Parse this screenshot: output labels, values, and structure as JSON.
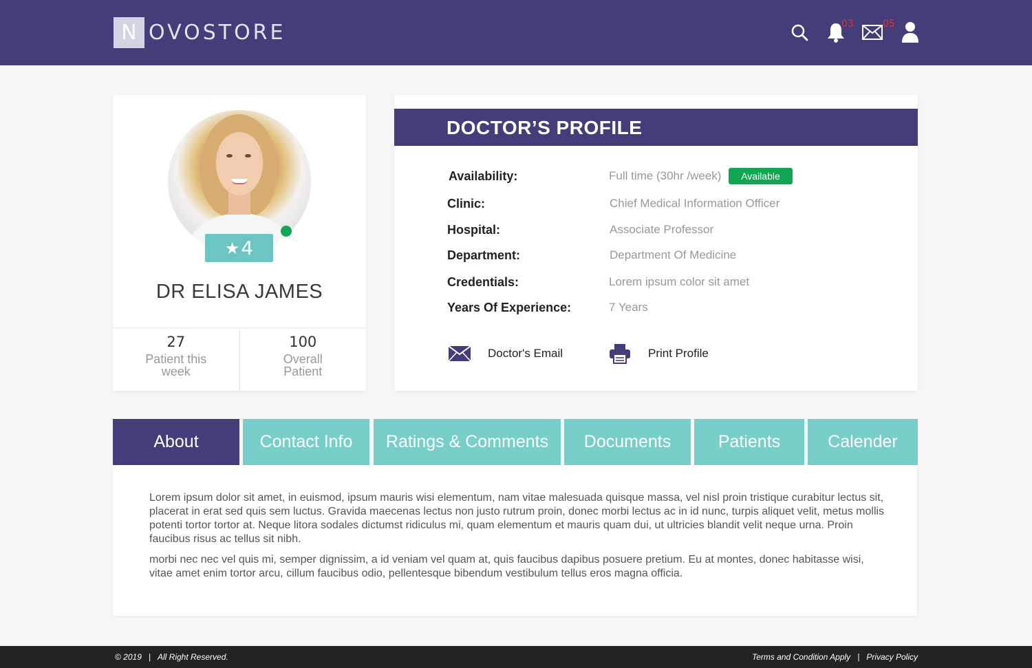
{
  "brand": {
    "logo_letter": "N",
    "logo_rest": "OVOSTORE"
  },
  "header": {
    "notifications_count": "03",
    "messages_count": "05",
    "icons": [
      "search-icon",
      "bell-icon",
      "mail-icon",
      "user-icon"
    ]
  },
  "doctor": {
    "name": "DR ELISA JAMES",
    "rating": "4",
    "status": "online",
    "stats": [
      {
        "value": "27",
        "label": "Patient this week"
      },
      {
        "value": "100",
        "label": "Overall Patient"
      }
    ]
  },
  "profile": {
    "title": "DOCTOR’S PROFILE",
    "rows": [
      {
        "key": "Availability",
        "value": "Full time (30hr /week)"
      },
      {
        "key": "Clinic",
        "value": "Chief Medical Information Officer"
      },
      {
        "key": "Hospital",
        "value": "Associate Professor"
      },
      {
        "key": "Department",
        "value": "Department Of Medicine"
      },
      {
        "key": "Credentials",
        "value": "Lorem ipsum color sit amet"
      },
      {
        "key": "Years Of Experience",
        "value": "7 Years"
      }
    ],
    "available_badge": "Available",
    "email_label": "Doctor's Email",
    "print_label": "Print Profile"
  },
  "tabs": [
    {
      "label": "About",
      "active": true
    },
    {
      "label": "Contact Info",
      "active": false
    },
    {
      "label": "Ratings & Comments",
      "active": false
    },
    {
      "label": "Documents",
      "active": false
    },
    {
      "label": "Patients",
      "active": false
    },
    {
      "label": "Calender",
      "active": false
    }
  ],
  "about": {
    "p1": "Lorem ipsum dolor sit amet, in euismod, ipsum mauris wisi elementum, nam vitae malesuada quisque massa, vel nisl proin tristique curabitur lectus sit, placerat in erat sed quis sem luctus. Gravida maecenas lectus non justo rutrum proin, donec morbi lectus ac in id nunc, turpis aliquet velit, metus mollis potenti tortor tortor at. Neque litora sodales dictumst ridiculus mi, quam elementum et mauris quam dui, ut ultricies blandit velit neque urna. Proin faucibus risus ac tellus sit nibh.",
    "p2": "morbi nec nec vel quis mi, semper dignissim, a id veniam vel quam at, quis faucibus dapibus posuere pretium. Eu at montes, donec habitasse wisi, vitae amet enim tortor arcu, cillum faucibus odio, pellentesque bibendum vestibulum tellus eros magna officia."
  },
  "footer": {
    "copyright": "© 2019",
    "rights": "All Right Reserved.",
    "terms": "Terms and Condition Apply",
    "privacy": "Privacy Policy"
  },
  "colors": {
    "primary": "#433d7a",
    "accent": "#78cec8",
    "success": "#10a653",
    "footer": "#232323"
  }
}
